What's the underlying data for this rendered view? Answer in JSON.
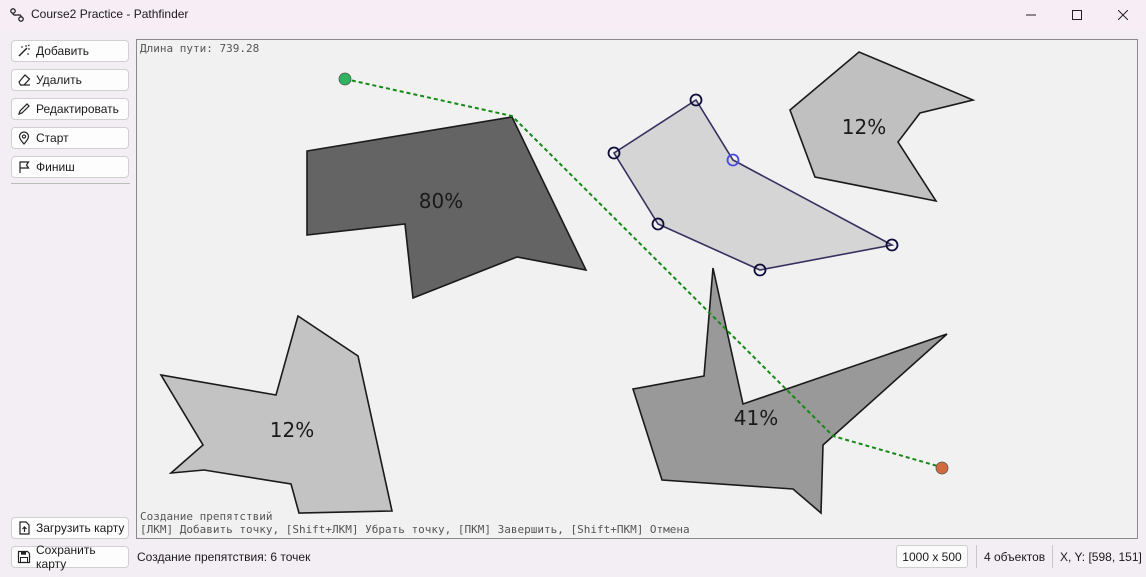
{
  "window": {
    "title": "Course2 Practice - Pathfinder"
  },
  "toolbar": {
    "add": "Добавить",
    "delete": "Удалить",
    "edit": "Редактировать",
    "start": "Старт",
    "finish": "Финиш",
    "load_map": "Загрузить карту",
    "save_map": "Сохранить карту"
  },
  "canvas": {
    "path_length_label": "Длина пути: 739.28",
    "mode_title": "Создание препятствий",
    "hint": "[ЛКМ] Добавить точку, [Shift+ЛКМ] Убрать точку, [ПКМ] Завершить, [Shift+ПКМ] Отмена",
    "obstacles": [
      {
        "label": "80%",
        "fill": "#646464"
      },
      {
        "label": "12%",
        "fill": "#c0c0c0"
      },
      {
        "label": "12%",
        "fill": "#c3c3c3"
      },
      {
        "label": "41%",
        "fill": "#999999"
      }
    ],
    "editing_polygon": {
      "fill": "#d5d5d5",
      "stroke": "#35305e",
      "vertex_count": 6
    },
    "start_color": "#2fb35f",
    "finish_color": "#d26a3f",
    "path_color": "#138a13"
  },
  "statusbar": {
    "message": "Создание препятствия: 6 точек",
    "map_size": "1000 x 500",
    "object_count": "4 объектов",
    "coords": "X, Y: [598, 151]"
  }
}
